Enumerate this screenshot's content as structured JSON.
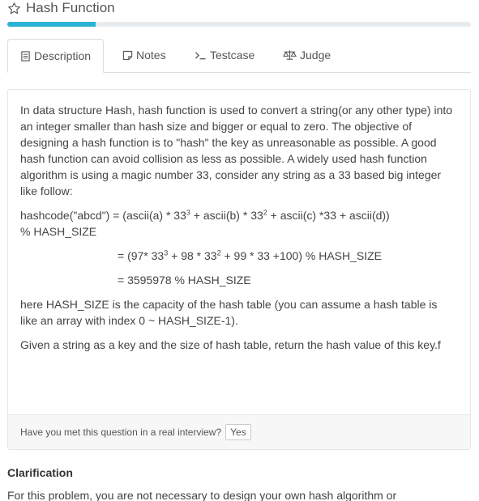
{
  "header": {
    "title": "Hash Function",
    "progress_percent": 19
  },
  "tabs": [
    {
      "label": "Description",
      "icon": "file-text-icon",
      "active": true
    },
    {
      "label": "Notes",
      "icon": "note-icon",
      "active": false
    },
    {
      "label": "Testcase",
      "icon": "terminal-icon",
      "active": false
    },
    {
      "label": "Judge",
      "icon": "scale-icon",
      "active": false
    }
  ],
  "description": {
    "intro": "In data structure Hash, hash function is used to convert a string(or any other type) into an integer smaller than hash size and bigger or equal to zero. The objective of designing a hash function is to \"hash\" the key as unreasonable as possible. A good hash function can avoid collision as less as possible. A widely used hash function algorithm is using a magic number 33, consider any string as a 33 based big integer like follow:",
    "formula1_a": "hashcode(\"abcd\") = (ascii(a) * 33",
    "formula1_sup1": "3",
    "formula1_b": " + ascii(b) * 33",
    "formula1_sup2": "2",
    "formula1_c": " + ascii(c) *33 + ascii(d))",
    "formula1_d": "% HASH_SIZE",
    "formula2_a": "= (97* 33",
    "formula2_sup1": "3",
    "formula2_b": " + 98 * 33",
    "formula2_sup2": "2",
    "formula2_c": " + 99 * 33 +100) % HASH_SIZE",
    "formula3": "= 3595978 % HASH_SIZE",
    "note": "here HASH_SIZE is the capacity of the hash table (you can assume a hash table is like an array with index 0 ~ HASH_SIZE-1).",
    "task": "Given a string as a key and the size of hash table, return the hash value of this key.f"
  },
  "footer": {
    "question": "Have you met this question in a real interview?",
    "yes_label": "Yes"
  },
  "clarification": {
    "title": "Clarification",
    "text": "For this problem, you are not necessary to design your own hash algorithm or"
  }
}
